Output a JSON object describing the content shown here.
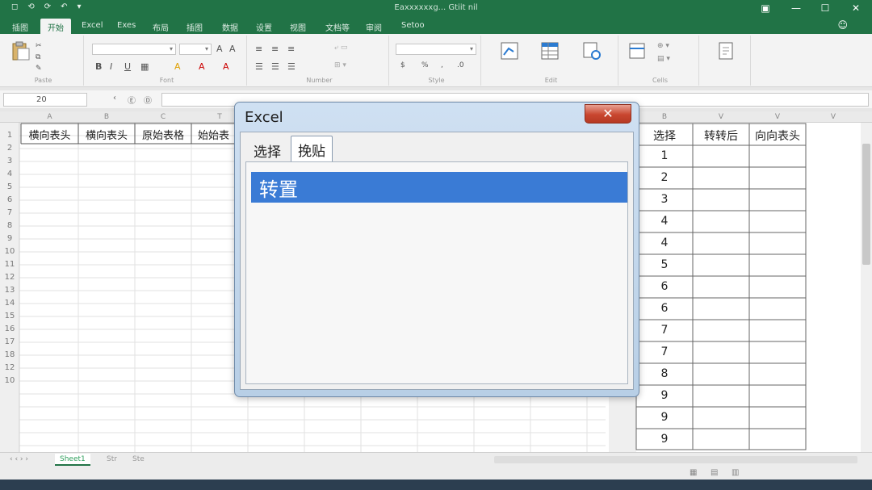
{
  "titlebar": {
    "qat": [
      "◻",
      "⟲",
      "⟳",
      "↶",
      "▾"
    ],
    "title": "Eaxxxxxxg... Gtiit nil",
    "controls": [
      "▣",
      "—",
      "☐",
      "✕"
    ]
  },
  "ribbon_tabs": [
    "插图",
    "开始",
    "Excel",
    "Exes",
    "布局",
    "插图",
    "数据",
    "设置",
    "视图",
    "文档等",
    "审阅",
    "Setoo"
  ],
  "ribbon_groups": [
    "Paste",
    "Font",
    "Number",
    "Style",
    "Edit",
    "Cells"
  ],
  "formula_bar": {
    "name_box": "20",
    "fx_icons": [
      "‹",
      "Ⓔ",
      "Ⓓ"
    ]
  },
  "columns_left": [
    "A",
    "B",
    "C",
    "T"
  ],
  "columns_right": [
    "B",
    "V",
    "V",
    "V"
  ],
  "row_numbers": [
    "1",
    "2",
    "3",
    "4",
    "5",
    "6",
    "7",
    "8",
    "9",
    "10",
    "11",
    "12",
    "13",
    "14",
    "15",
    "16",
    "17",
    "18",
    "12",
    "10"
  ],
  "left_headers": [
    "横向表头",
    "横向表头",
    "原始表格",
    "始始表"
  ],
  "right_headers": [
    "选择",
    "转转后",
    "向向表头"
  ],
  "right_values": [
    "1",
    "2",
    "3",
    "4",
    "4",
    "5",
    "6",
    "6",
    "7",
    "7",
    "8",
    "9",
    "9",
    "9"
  ],
  "sheet_tabs": [
    "Sheet1",
    "Str",
    "Ste"
  ],
  "dialog": {
    "title": "Excel",
    "close": "✕",
    "tabs": [
      "选择",
      "挽贴"
    ],
    "items": [
      "转置"
    ]
  }
}
